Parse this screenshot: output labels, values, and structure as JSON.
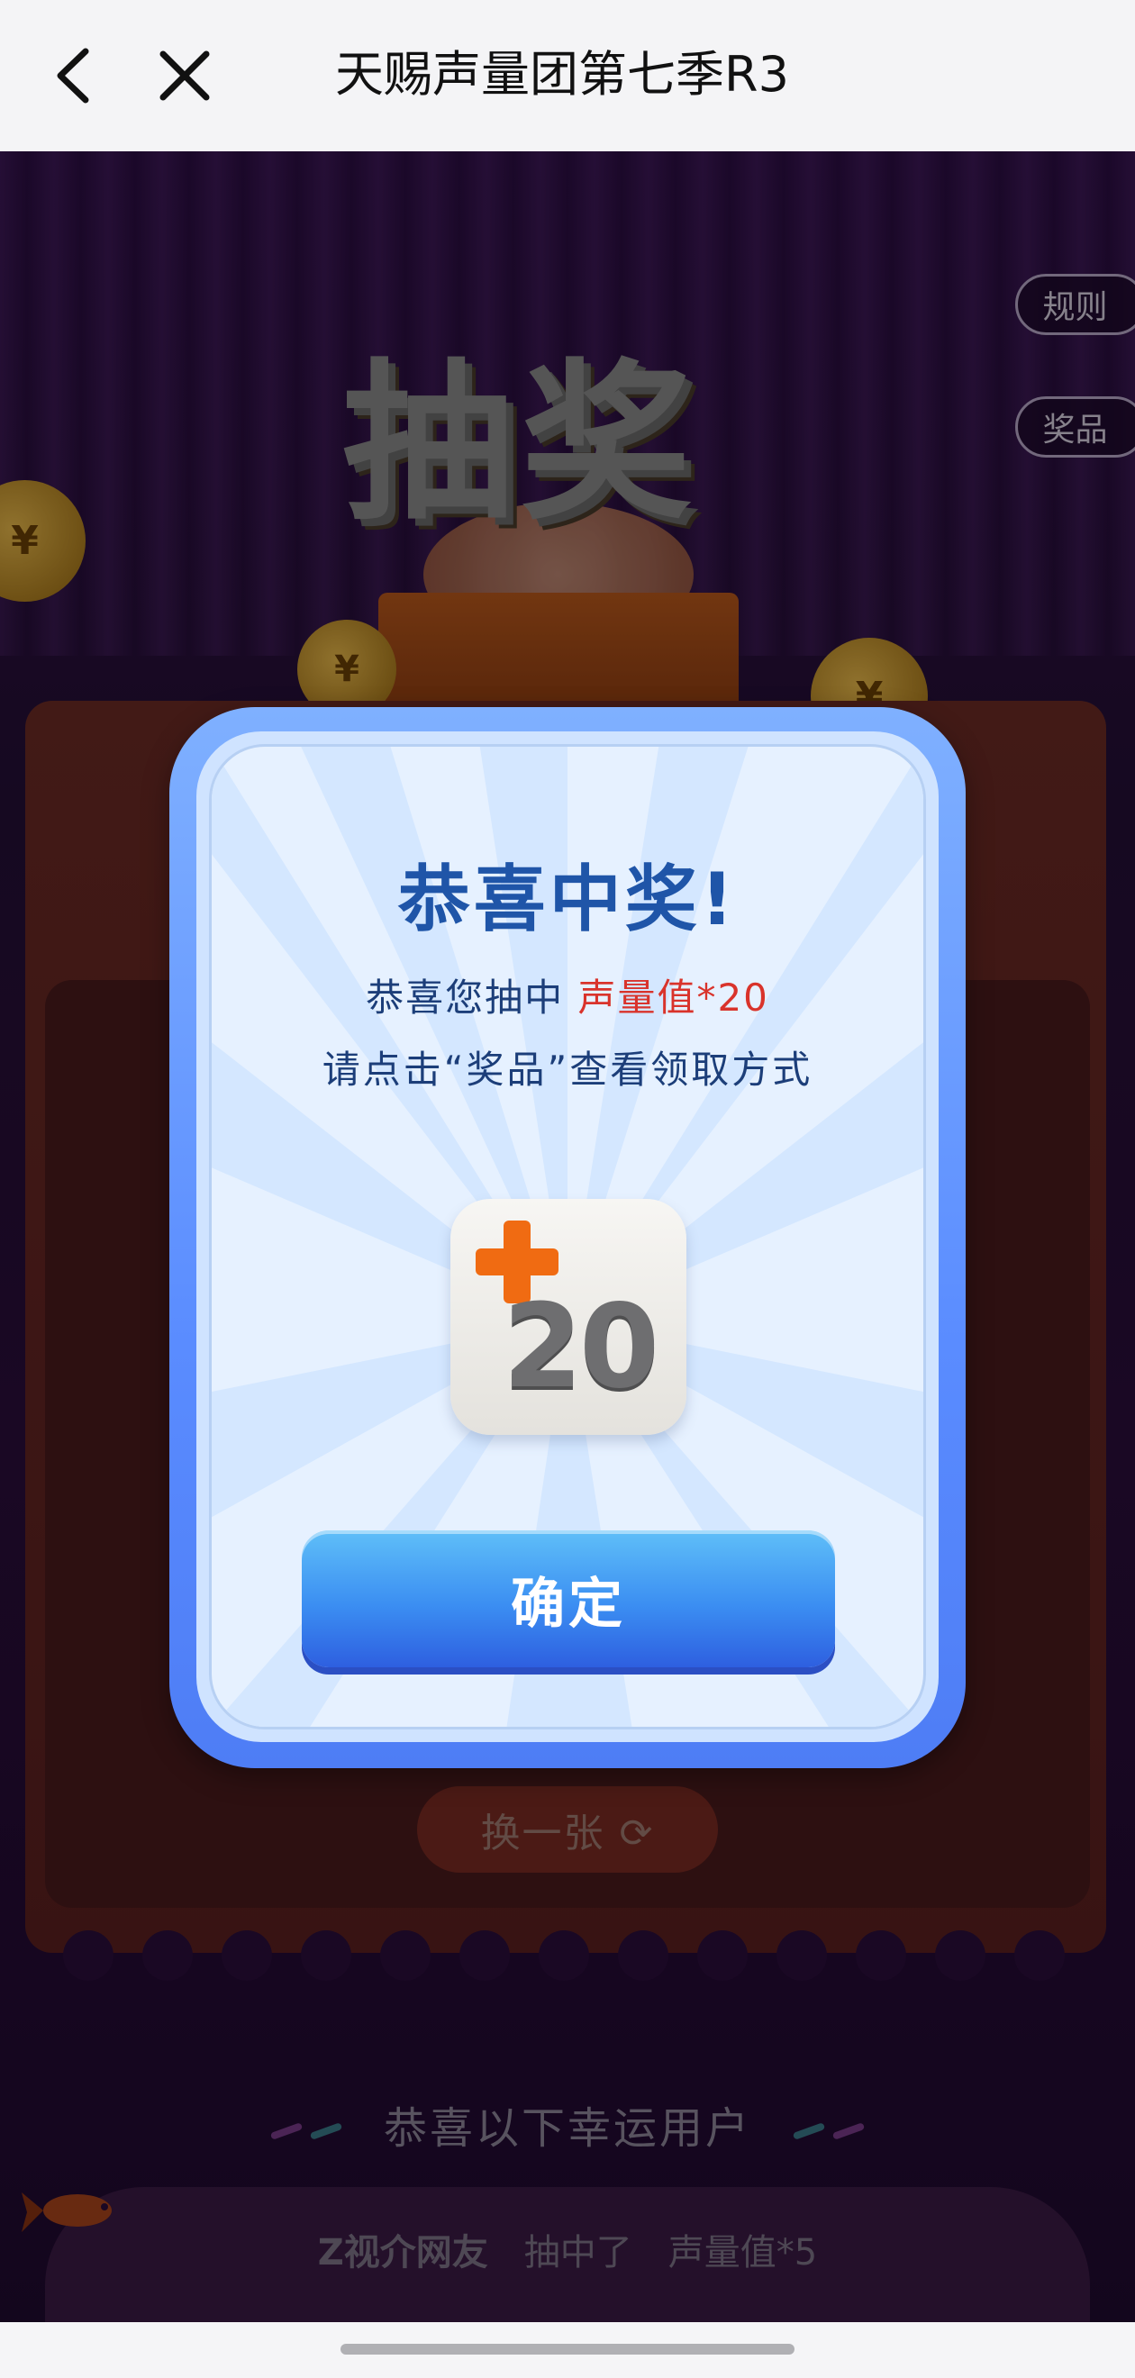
{
  "navbar": {
    "title": "天赐声量团第七季R3",
    "back_icon": "chevron-left-icon",
    "close_icon": "close-icon"
  },
  "page": {
    "rules_label": "规则",
    "prizes_label": "奖品",
    "big_title": "抽奖",
    "coin_symbol": "¥",
    "swap_label": "换一张 ⟳",
    "winners_heading": "恭喜以下幸运用户",
    "winner": {
      "username": "Z视介网友",
      "action": "抽中了",
      "prize": "声量值*5"
    }
  },
  "modal": {
    "title": "恭喜中奖!",
    "line1_prefix": "恭喜您抽中 ",
    "line1_prize": "声量值*20",
    "line2": "请点击“奖品”查看领取方式",
    "reward_value": "20",
    "confirm_label": "确定"
  },
  "colors": {
    "modal_frame": "#5a8cff",
    "title_blue": "#1f55a8",
    "prize_red": "#d9332b",
    "reward_plus": "#f06b12"
  }
}
